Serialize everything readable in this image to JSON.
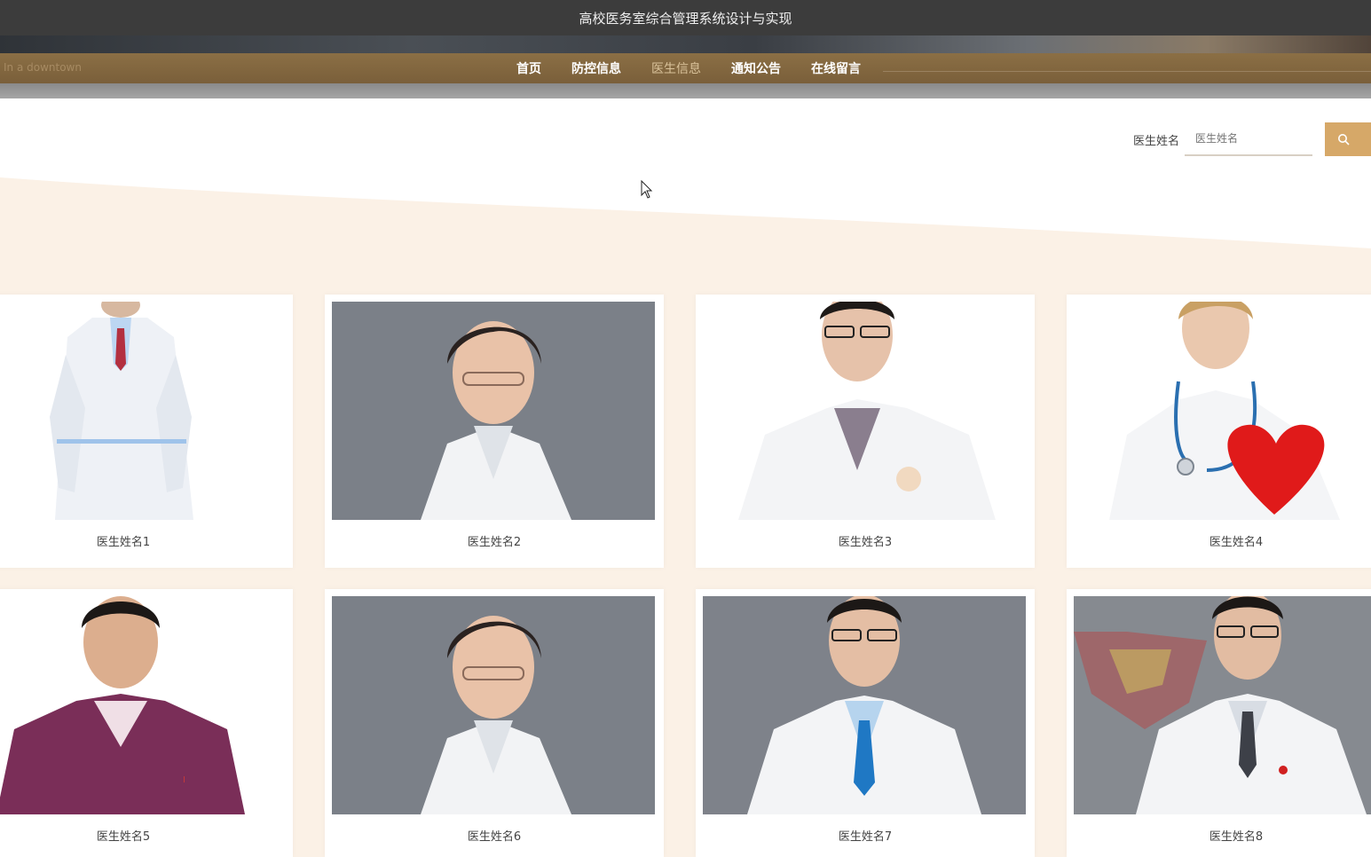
{
  "header": {
    "title": "高校医务室综合管理系统设计与实现"
  },
  "nav": {
    "brand": "In a downtown",
    "items": [
      {
        "label": "首页",
        "active": false
      },
      {
        "label": "防控信息",
        "active": false
      },
      {
        "label": "医生信息",
        "active": true
      },
      {
        "label": "通知公告",
        "active": false
      },
      {
        "label": "在线留言",
        "active": false
      }
    ]
  },
  "search": {
    "label": "医生姓名",
    "placeholder": "医生姓名",
    "button_icon": "search-icon"
  },
  "doctors": [
    {
      "name": "医生姓名1",
      "photo": "doctor-white-coat-photo"
    },
    {
      "name": "医生姓名2",
      "photo": "female-doctor-photo"
    },
    {
      "name": "医生姓名3",
      "photo": "male-doctor-glasses-photo"
    },
    {
      "name": "医生姓名4",
      "photo": "nurse-heart-photo"
    },
    {
      "name": "医生姓名5",
      "photo": "male-purple-sweater-photo"
    },
    {
      "name": "医生姓名6",
      "photo": "female-doctor-photo"
    },
    {
      "name": "医生姓名7",
      "photo": "male-doctor-glasses-photo"
    },
    {
      "name": "医生姓名8",
      "photo": "male-doctor-badge-photo"
    }
  ],
  "colors": {
    "nav_bg": "#8b6f45",
    "accent": "#d6a868",
    "content_bg": "#fbf1e6"
  }
}
